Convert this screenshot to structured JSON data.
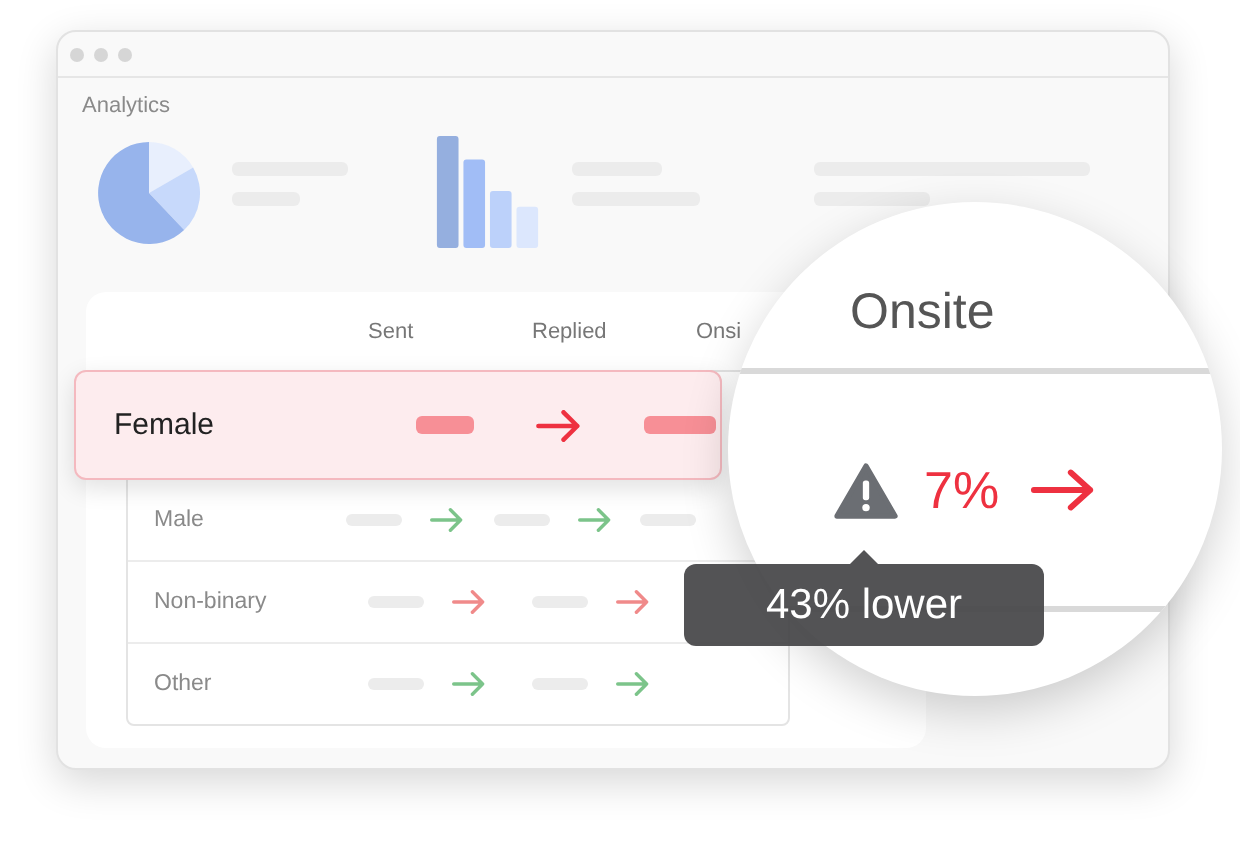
{
  "window": {
    "title": "Analytics"
  },
  "table": {
    "columns": [
      "Sent",
      "Replied",
      "Onsi"
    ],
    "rows": [
      {
        "label": "Female",
        "highlighted": true,
        "flagged": true
      },
      {
        "label": "Male",
        "highlighted": false,
        "flagged": false
      },
      {
        "label": "Non-binary",
        "highlighted": false,
        "flagged": true
      },
      {
        "label": "Other",
        "highlighted": false,
        "flagged": false
      }
    ]
  },
  "magnifier": {
    "column": "Onsite",
    "value": "7%",
    "flagged": true
  },
  "tooltip": {
    "text": "43% lower"
  }
}
